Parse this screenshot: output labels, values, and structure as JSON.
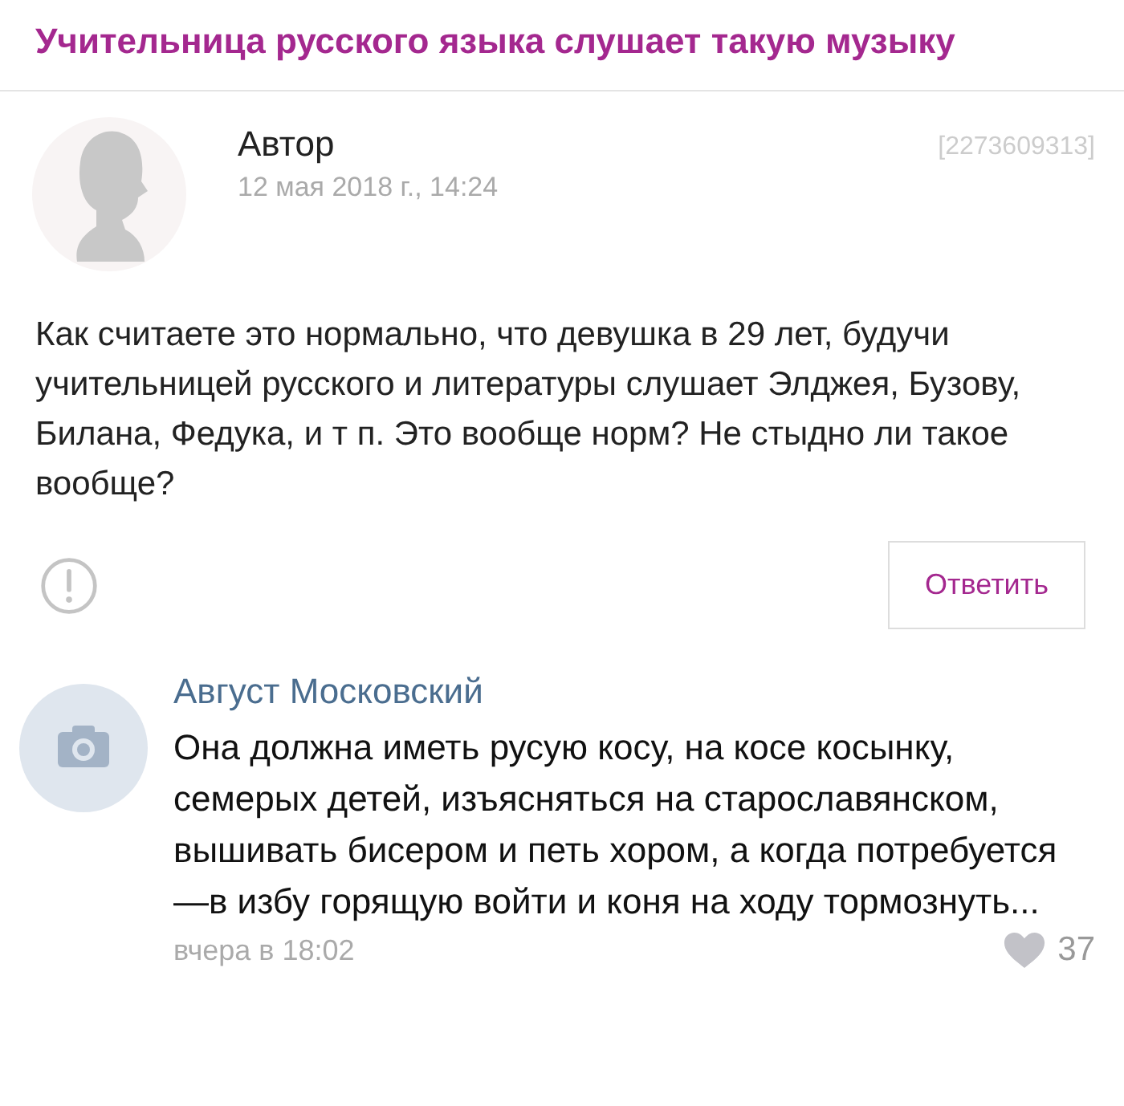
{
  "title": "Учительница русского языка слушает такую музыку",
  "question": {
    "author": "Автор",
    "date": "12 мая 2018 г., 14:24",
    "id": "[2273609313]",
    "text": "Как считаете это нормально, что девушка в 29 лет, будучи учительницей русского и литературы слушает Элджея, Бузову, Билана, Федука, и т п. Это вообще норм? Не стыдно ли такое вообще?",
    "reply_button": "Ответить"
  },
  "comment": {
    "author": "Август Московский",
    "text": "Она должна иметь русую косу, на косе косынку, семерых детей, изъясняться на старославянском, вышивать бисером и петь хором, а когда потребуется—в избу горящую войти и коня на ходу тормознуть...",
    "time": "вчера в 18:02",
    "likes": "37"
  }
}
